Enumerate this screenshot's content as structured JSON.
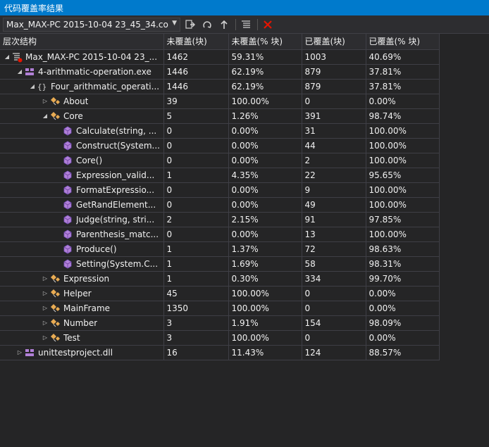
{
  "window": {
    "title": "代码覆盖率结果"
  },
  "toolbar": {
    "combo_value": "Max_MAX-PC 2015-10-04 23_45_34.cove",
    "buttons": [
      "export-icon",
      "import-icon",
      "merge-icon",
      "columns-icon",
      "remove-icon"
    ]
  },
  "columns": {
    "hierarchy": "层次结构",
    "not_covered_blocks": "未覆盖(块)",
    "not_covered_pct": "未覆盖(% 块)",
    "covered_blocks": "已覆盖(块)",
    "covered_pct": "已覆盖(% 块)"
  },
  "rows": [
    {
      "level": 0,
      "expander": "◢",
      "icon": "coverage-result-icon",
      "name": "Max_MAX-PC 2015-10-04 23_...",
      "nc": "1462",
      "ncp": "59.31%",
      "c": "1003",
      "cp": "40.69%"
    },
    {
      "level": 1,
      "expander": "◢",
      "icon": "assembly-icon",
      "name": "4-arithmatic-operation.exe",
      "nc": "1446",
      "ncp": "62.19%",
      "c": "879",
      "cp": "37.81%"
    },
    {
      "level": 2,
      "expander": "◢",
      "icon": "namespace-icon",
      "name": "Four_arithmatic_operati...",
      "nc": "1446",
      "ncp": "62.19%",
      "c": "879",
      "cp": "37.81%"
    },
    {
      "level": 3,
      "expander": "▷",
      "icon": "class-icon",
      "name": "About",
      "nc": "39",
      "ncp": "100.00%",
      "c": "0",
      "cp": "0.00%"
    },
    {
      "level": 3,
      "expander": "◢",
      "icon": "class-icon",
      "name": "Core",
      "nc": "5",
      "ncp": "1.26%",
      "c": "391",
      "cp": "98.74%"
    },
    {
      "level": 4,
      "expander": "",
      "icon": "method-icon",
      "name": "Calculate(string, ...",
      "nc": "0",
      "ncp": "0.00%",
      "c": "31",
      "cp": "100.00%"
    },
    {
      "level": 4,
      "expander": "",
      "icon": "method-icon",
      "name": "Construct(System...",
      "nc": "0",
      "ncp": "0.00%",
      "c": "44",
      "cp": "100.00%"
    },
    {
      "level": 4,
      "expander": "",
      "icon": "method-icon",
      "name": "Core()",
      "nc": "0",
      "ncp": "0.00%",
      "c": "2",
      "cp": "100.00%"
    },
    {
      "level": 4,
      "expander": "",
      "icon": "method-icon",
      "name": "Expression_valid...",
      "nc": "1",
      "ncp": "4.35%",
      "c": "22",
      "cp": "95.65%"
    },
    {
      "level": 4,
      "expander": "",
      "icon": "method-icon",
      "name": "FormatExpressio...",
      "nc": "0",
      "ncp": "0.00%",
      "c": "9",
      "cp": "100.00%"
    },
    {
      "level": 4,
      "expander": "",
      "icon": "method-icon",
      "name": "GetRandElement...",
      "nc": "0",
      "ncp": "0.00%",
      "c": "49",
      "cp": "100.00%"
    },
    {
      "level": 4,
      "expander": "",
      "icon": "method-icon",
      "name": "Judge(string, stri...",
      "nc": "2",
      "ncp": "2.15%",
      "c": "91",
      "cp": "97.85%"
    },
    {
      "level": 4,
      "expander": "",
      "icon": "method-icon",
      "name": "Parenthesis_matc...",
      "nc": "0",
      "ncp": "0.00%",
      "c": "13",
      "cp": "100.00%"
    },
    {
      "level": 4,
      "expander": "",
      "icon": "method-icon",
      "name": "Produce()",
      "nc": "1",
      "ncp": "1.37%",
      "c": "72",
      "cp": "98.63%"
    },
    {
      "level": 4,
      "expander": "",
      "icon": "method-icon",
      "name": "Setting(System.C...",
      "nc": "1",
      "ncp": "1.69%",
      "c": "58",
      "cp": "98.31%"
    },
    {
      "level": 3,
      "expander": "▷",
      "icon": "class-icon",
      "name": "Expression",
      "nc": "1",
      "ncp": "0.30%",
      "c": "334",
      "cp": "99.70%"
    },
    {
      "level": 3,
      "expander": "▷",
      "icon": "class-icon",
      "name": "Helper",
      "nc": "45",
      "ncp": "100.00%",
      "c": "0",
      "cp": "0.00%"
    },
    {
      "level": 3,
      "expander": "▷",
      "icon": "class-icon",
      "name": "MainFrame",
      "nc": "1350",
      "ncp": "100.00%",
      "c": "0",
      "cp": "0.00%"
    },
    {
      "level": 3,
      "expander": "▷",
      "icon": "class-icon",
      "name": "Number",
      "nc": "3",
      "ncp": "1.91%",
      "c": "154",
      "cp": "98.09%"
    },
    {
      "level": 3,
      "expander": "▷",
      "icon": "class-icon",
      "name": "Test",
      "nc": "3",
      "ncp": "100.00%",
      "c": "0",
      "cp": "0.00%"
    },
    {
      "level": 1,
      "expander": "▷",
      "icon": "assembly-icon",
      "name": "unittestproject.dll",
      "nc": "16",
      "ncp": "11.43%",
      "c": "124",
      "cp": "88.57%"
    }
  ],
  "colors": {
    "accent": "#007acc",
    "background": "#252526",
    "grid": "#3f3f46",
    "assembly": "#b180d7",
    "class": "#e8ab53",
    "remove": "#e51400"
  }
}
